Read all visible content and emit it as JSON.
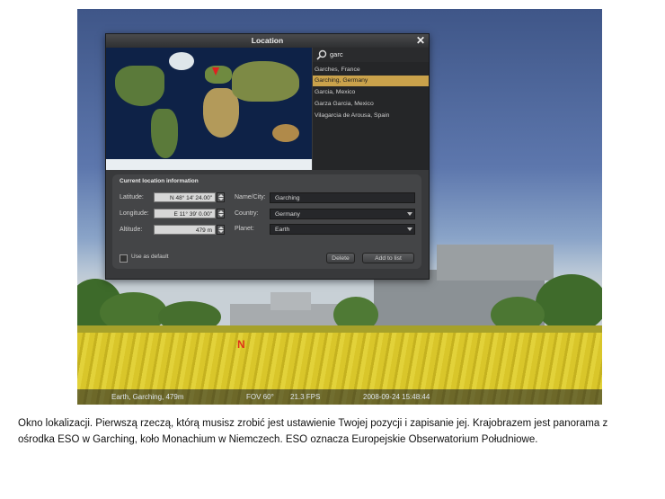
{
  "dialog": {
    "title": "Location",
    "search_value": "garc",
    "results": [
      "Garches, France",
      "Garching, Germany",
      "Garcia, Mexico",
      "Garza Garcia, Mexico",
      "Vilagarcia de Arousa, Spain"
    ],
    "selected_index": 1,
    "current_location_title": "Current location information",
    "latitude_label": "Latitude:",
    "latitude_value": "N 48° 14' 24.00\"",
    "longitude_label": "Longitude:",
    "longitude_value": "E 11° 39' 0.00\"",
    "altitude_label": "Altitude:",
    "altitude_value": "479 m",
    "name_label": "Name/City:",
    "name_value": "Garching",
    "country_label": "Country:",
    "country_value": "Germany",
    "planet_label": "Planet:",
    "planet_value": "Earth",
    "use_default_label": "Use as default",
    "delete_label": "Delete",
    "add_label": "Add to list"
  },
  "statusbar": {
    "location": "Earth, Garching, 479m",
    "fov": "FOV 60°",
    "fps": "21.3 FPS",
    "datetime": "2008-09-24   15:48:44"
  },
  "compass": "N",
  "caption": "Okno lokalizacji. Pierwszą rzeczą, którą musisz zrobić jest ustawienie Twojej pozycji i zapisanie jej. Krajobrazem jest panorama z ośrodka ESO w Garching, koło Monachium w Niemczech. ESO oznacza Europejskie Obserwatorium Południowe."
}
